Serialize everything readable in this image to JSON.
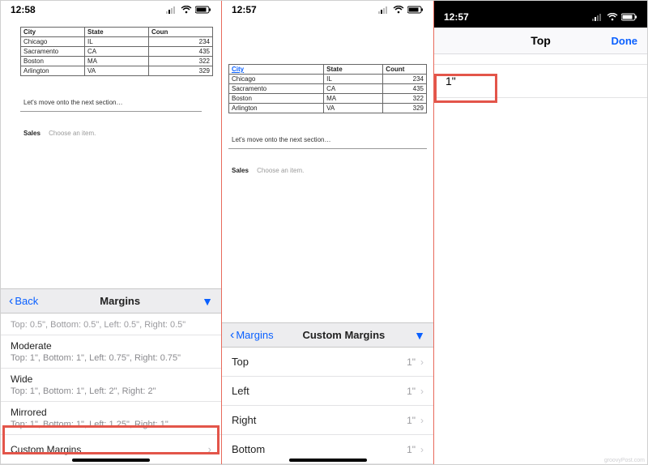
{
  "panel1": {
    "time": "12:58",
    "table": {
      "headers": {
        "city": "City",
        "state": "State",
        "count": "Coun"
      },
      "rows": [
        {
          "city": "Chicago",
          "state": "IL",
          "count": "234"
        },
        {
          "city": "Sacramento",
          "state": "CA",
          "count": "435"
        },
        {
          "city": "Boston",
          "state": "MA",
          "count": "322"
        },
        {
          "city": "Arlington",
          "state": "VA",
          "count": "329"
        }
      ]
    },
    "body_text": "Let's move onto the next section…",
    "sales_label": "Sales",
    "sales_choose": "Choose an item.",
    "sheet": {
      "back": "Back",
      "title": "Margins",
      "truncated_sub": "Top: 0.5\", Bottom: 0.5\", Left: 0.5\", Right: 0.5\"",
      "options": [
        {
          "title": "Moderate",
          "sub": "Top: 1\", Bottom: 1\", Left: 0.75\", Right: 0.75\""
        },
        {
          "title": "Wide",
          "sub": "Top: 1\", Bottom: 1\", Left: 2\", Right: 2\""
        },
        {
          "title": "Mirrored",
          "sub": "Top: 1\", Bottom: 1\", Left: 1.25\", Right: 1\""
        }
      ],
      "custom": "Custom Margins"
    }
  },
  "panel2": {
    "time": "12:57",
    "table": {
      "headers": {
        "city": "City",
        "state": "State",
        "count": "Count"
      },
      "rows": [
        {
          "city": "Chicago",
          "state": "IL",
          "count": "234"
        },
        {
          "city": "Sacramento",
          "state": "CA",
          "count": "435"
        },
        {
          "city": "Boston",
          "state": "MA",
          "count": "322"
        },
        {
          "city": "Arlington",
          "state": "VA",
          "count": "329"
        }
      ]
    },
    "body_text": "Let's move onto the next section…",
    "sales_label": "Sales",
    "sales_choose": "Choose an item.",
    "sheet": {
      "back": "Margins",
      "title": "Custom Margins",
      "rows": [
        {
          "k": "Top",
          "v": "1\""
        },
        {
          "k": "Left",
          "v": "1\""
        },
        {
          "k": "Right",
          "v": "1\""
        },
        {
          "k": "Bottom",
          "v": "1\""
        }
      ]
    }
  },
  "panel3": {
    "time": "12:57",
    "nav": {
      "title": "Top",
      "done": "Done"
    },
    "value": "1\""
  },
  "watermark": "groovyPost.com"
}
